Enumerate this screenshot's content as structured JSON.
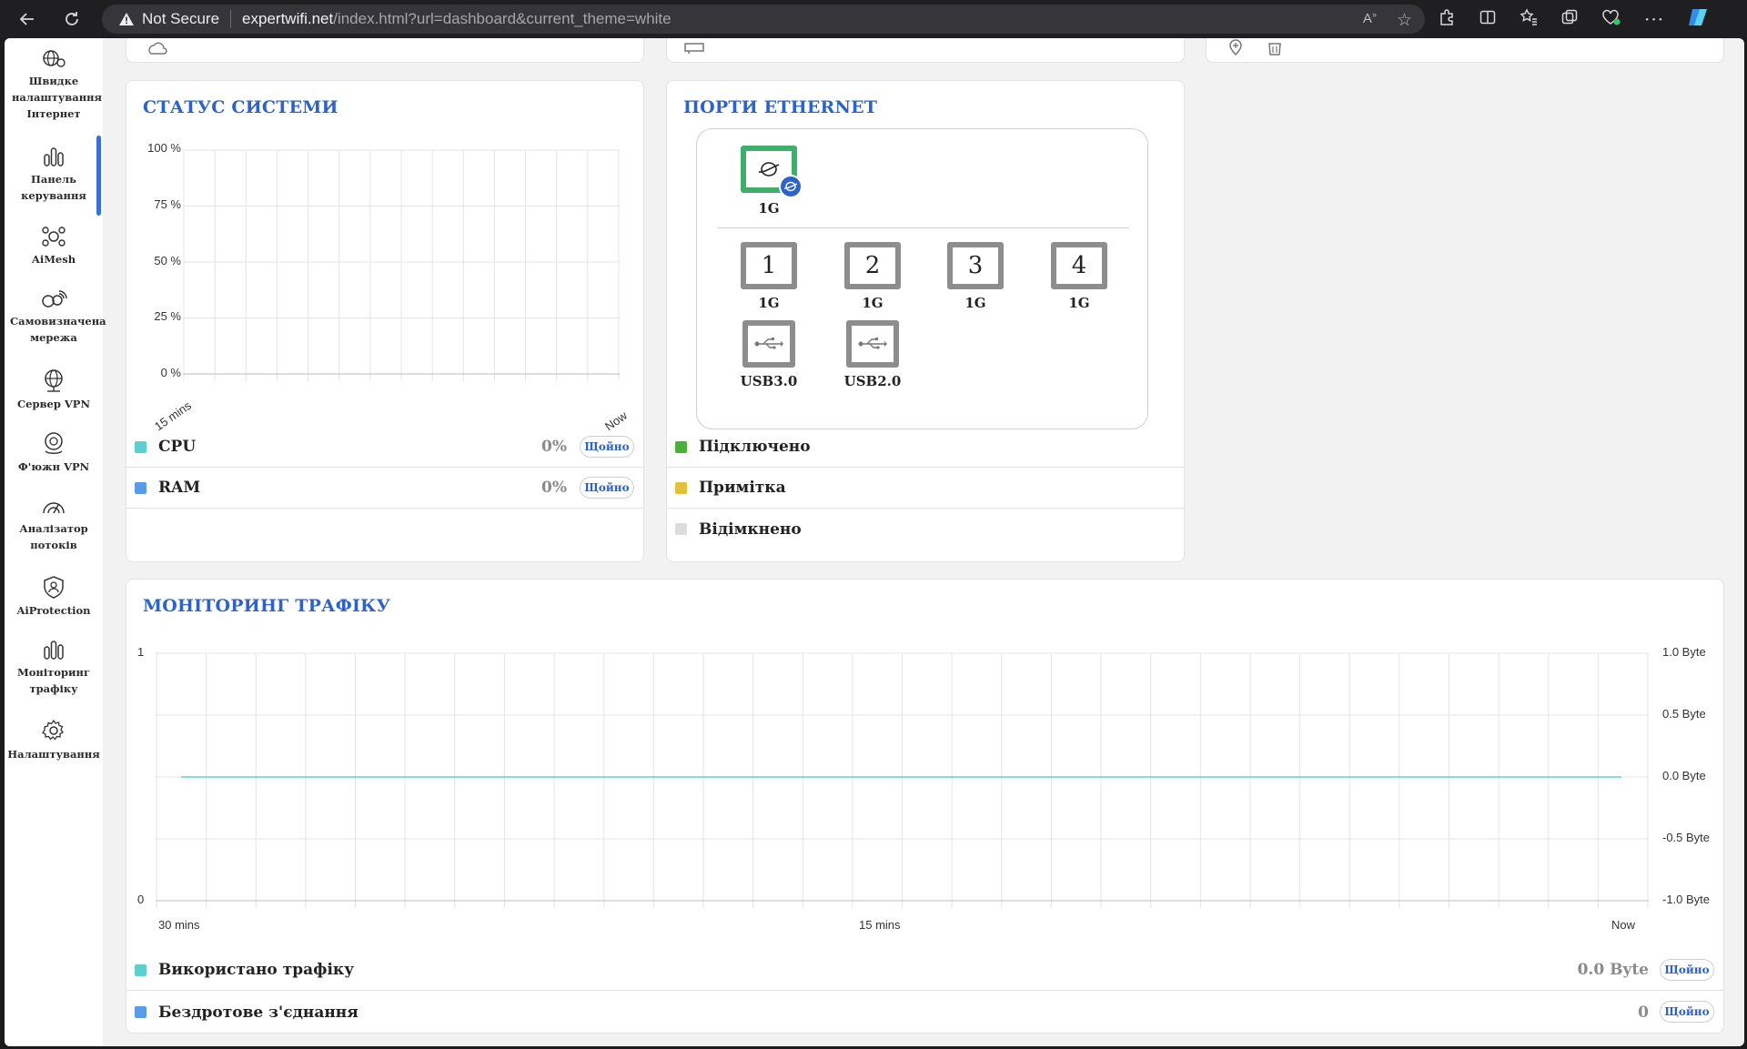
{
  "browser": {
    "security_label": "Not Secure",
    "url_host": "expertwifi.net",
    "url_path": "/index.html?url=dashboard&current_theme=white"
  },
  "sidebar": {
    "items": [
      {
        "label": "Швидке налаштування Інтернет",
        "icon": "globe-setup-icon"
      },
      {
        "label": "Панель керування",
        "icon": "bar-chart-icon"
      },
      {
        "label": "AiMesh",
        "icon": "aimesh-icon"
      },
      {
        "label": "Самовизначена мережа",
        "icon": "network-icon"
      },
      {
        "label": "Сервер VPN",
        "icon": "vpn-server-icon"
      },
      {
        "label": "Ф'южн VPN",
        "icon": "vpn-fusion-icon"
      },
      {
        "label": "Аналізатор потоків",
        "icon": "flow-analyzer-icon"
      },
      {
        "label": "AiProtection",
        "icon": "shield-icon"
      },
      {
        "label": "Моніторинг трафіку",
        "icon": "traffic-chart-icon"
      },
      {
        "label": "Налаштування",
        "icon": "gear-icon"
      }
    ],
    "active_index": 1
  },
  "system_status": {
    "title": "СТАТУС СИСТЕМИ",
    "rows": [
      {
        "label": "CPU",
        "value": "0%",
        "button": "Щойно",
        "color": "#5ecfcf"
      },
      {
        "label": "RAM",
        "value": "0%",
        "button": "Щойно",
        "color": "#5a9ae6"
      }
    ]
  },
  "ethernet": {
    "title": "ПОРТИ ETHERNET",
    "wan": {
      "speed": "1G"
    },
    "lan_ports": [
      {
        "number": "1",
        "speed": "1G"
      },
      {
        "number": "2",
        "speed": "1G"
      },
      {
        "number": "3",
        "speed": "1G"
      },
      {
        "number": "4",
        "speed": "1G"
      }
    ],
    "usb_ports": [
      {
        "label": "USB3.0"
      },
      {
        "label": "USB2.0"
      }
    ],
    "legend": [
      {
        "label": "Підключено",
        "color": "#4caf3c"
      },
      {
        "label": "Примітка",
        "color": "#e2c23a"
      },
      {
        "label": "Відімкнено",
        "color": "#dcdcdc"
      }
    ]
  },
  "traffic": {
    "title": "МОНІТОРИНГ ТРАФІКУ",
    "rows": [
      {
        "label": "Використано трафіку",
        "value": "0.0 Byte",
        "button": "Щойно",
        "color": "#5ecfcf"
      },
      {
        "label": "Бездротове з'єднання",
        "value": "0",
        "button": "Щойно",
        "color": "#5a9ae6"
      }
    ]
  },
  "chart_data": [
    {
      "type": "line",
      "title": "",
      "y_ticks": [
        "100 %",
        "75 %",
        "50 %",
        "25 %",
        "0 %"
      ],
      "x_ticks": [
        "15 mins",
        "Now"
      ],
      "ylim": [
        0,
        100
      ],
      "grid": true,
      "series": [
        {
          "name": "CPU",
          "values": []
        },
        {
          "name": "RAM",
          "values": []
        }
      ]
    },
    {
      "type": "line",
      "title": "",
      "left_ticks": [
        "1",
        "0"
      ],
      "right_ticks": [
        "1.0 Byte",
        "0.5 Byte",
        "0.0 Byte",
        "-0.5 Byte",
        "-1.0 Byte"
      ],
      "x_ticks": [
        "30 mins",
        "15 mins",
        "Now"
      ],
      "ylim": [
        -1,
        1
      ],
      "grid": true,
      "series": [
        {
          "name": "Використано трафіку",
          "values": [
            0,
            0
          ]
        }
      ]
    }
  ]
}
